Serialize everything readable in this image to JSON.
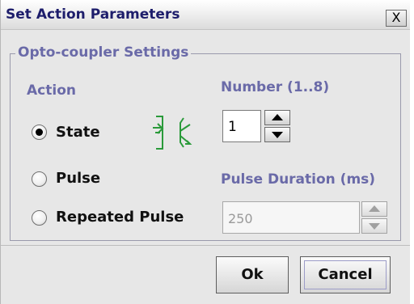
{
  "window": {
    "title": "Set Action Parameters",
    "close_glyph": "X"
  },
  "group": {
    "title": "Opto-coupler Settings"
  },
  "action": {
    "heading": "Action",
    "options": [
      {
        "label": "State",
        "selected": true
      },
      {
        "label": "Pulse",
        "selected": false
      },
      {
        "label": "Repeated Pulse",
        "selected": false
      }
    ],
    "indicator_icon": "opto-coupler-icon",
    "indicator_color": "#2a9a3a"
  },
  "number": {
    "heading": "Number (1..8)",
    "value": "1"
  },
  "pulse_duration": {
    "heading": "Pulse Duration (ms)",
    "value": "250",
    "enabled": false
  },
  "buttons": {
    "ok": "Ok",
    "cancel": "Cancel"
  },
  "colors": {
    "label_blue": "#6a6aa8",
    "title_text": "#1d1d6b"
  }
}
